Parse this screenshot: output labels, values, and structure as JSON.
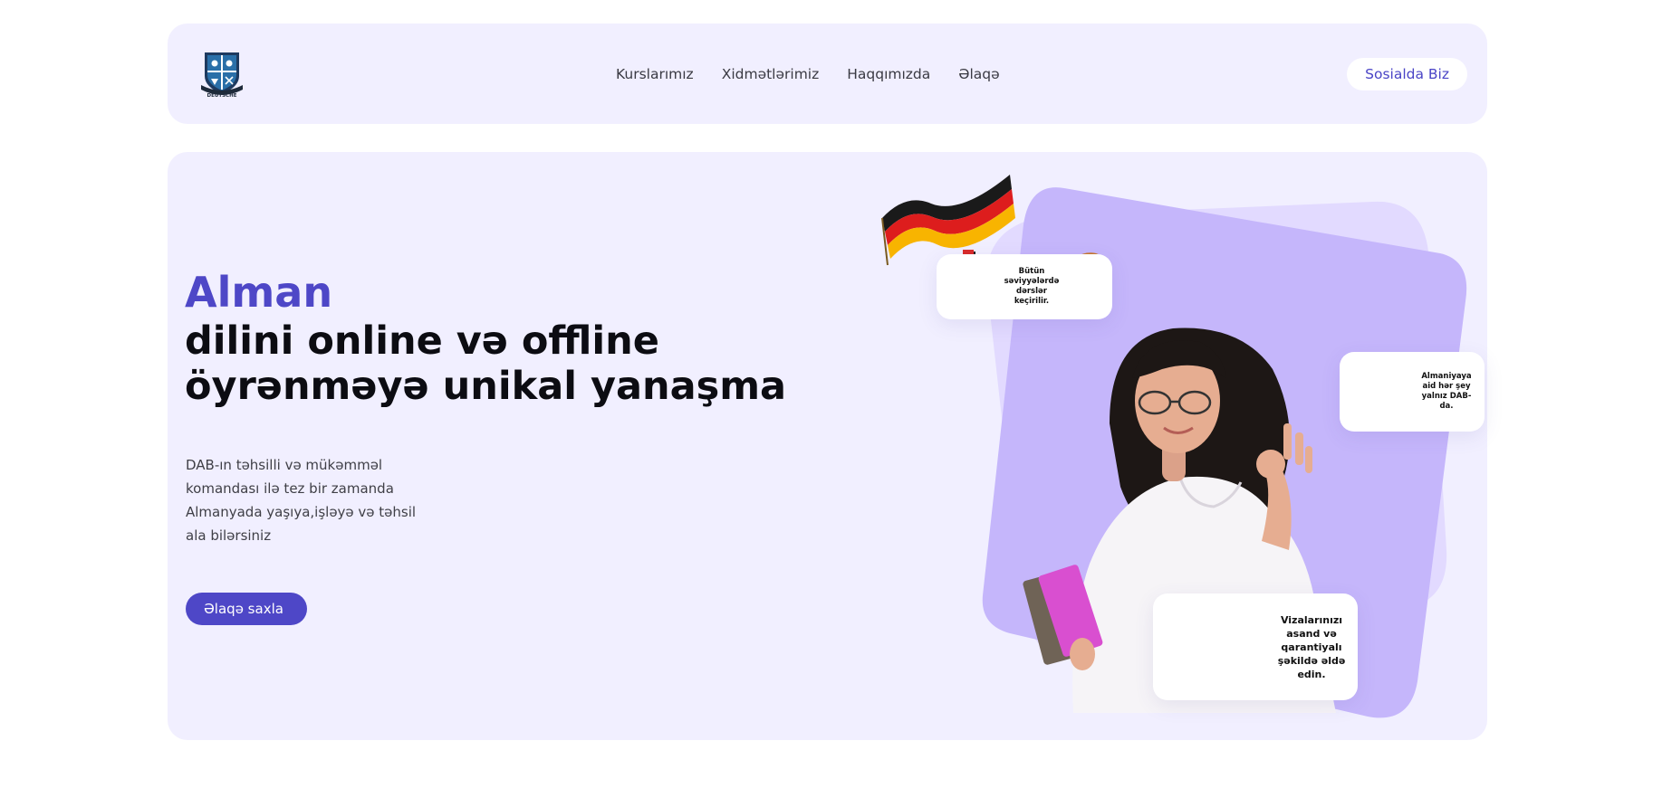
{
  "header": {
    "nav": [
      "Kurslarımız",
      "Xidmətlərimiz",
      "Haqqımızda",
      "Əlaqə"
    ],
    "social_button": "Sosialda Biz"
  },
  "logo": {
    "text": "DEUTSCHE",
    "icon": "shield-crest-icon"
  },
  "hero": {
    "accent": "Alman",
    "title_line1": "dilini online və offline",
    "title_line2": "öyrənməyə unikal yanaşma",
    "description": "DAB-ın təhsilli və mükəmməl komandası ilə tez bir zamanda Almanyada yaşıya,işləyə və təhsil ala bilərsiniz",
    "cta_label": "Əlaqə saxla"
  },
  "cards": [
    {
      "text": "Bütün səviyyələrdə dərslər keçirilir.",
      "icon": "pretzel-icon"
    },
    {
      "text": "Almaniyaya aid hər şey yalnız DAB-da.",
      "icon": "germany-map-icon"
    },
    {
      "text": "Vizalarınızı asand və qarantiyalı şəkildə əldə edin.",
      "icon": "passport-stamps-icon"
    }
  ],
  "colors": {
    "accent": "#4e47c7",
    "panel": "#f1efff",
    "shape": "#c5b6fb",
    "shape_back": "#e2daff"
  }
}
